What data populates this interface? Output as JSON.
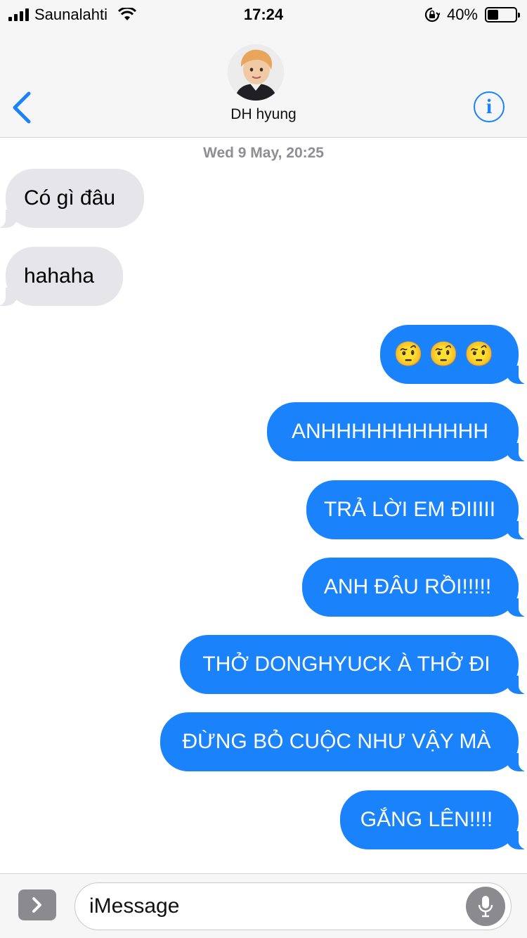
{
  "status_bar": {
    "carrier": "Saunalahti",
    "time": "17:24",
    "battery_percent": "40%",
    "battery_level": 0.4
  },
  "header": {
    "contact_name": "DH hyung",
    "info_glyph": "i"
  },
  "conversation": {
    "timestamp": "Wed 9 May, 20:25",
    "incoming": [
      {
        "text": "Có gì đâu"
      },
      {
        "text": "hahaha"
      }
    ],
    "outgoing": [
      {
        "text": "🤨🤨🤨"
      },
      {
        "text": "ANHHHHHHHHHHH"
      },
      {
        "text": "TRẢ LỜI EM ĐIIIII"
      },
      {
        "text": "ANH ĐÂU RỒI!!!!!"
      },
      {
        "text": "THỞ DONGHYUCK À THỞ ĐI"
      },
      {
        "text": "ĐỪNG BỎ CUỘC NHƯ VẬY MÀ"
      },
      {
        "text": "GẮNG LÊN!!!!"
      }
    ]
  },
  "input_bar": {
    "placeholder": "iMessage"
  },
  "colors": {
    "accent": "#1a82fb",
    "incoming_bubble": "#e5e5ea",
    "nav_background": "#f6f6f7"
  }
}
